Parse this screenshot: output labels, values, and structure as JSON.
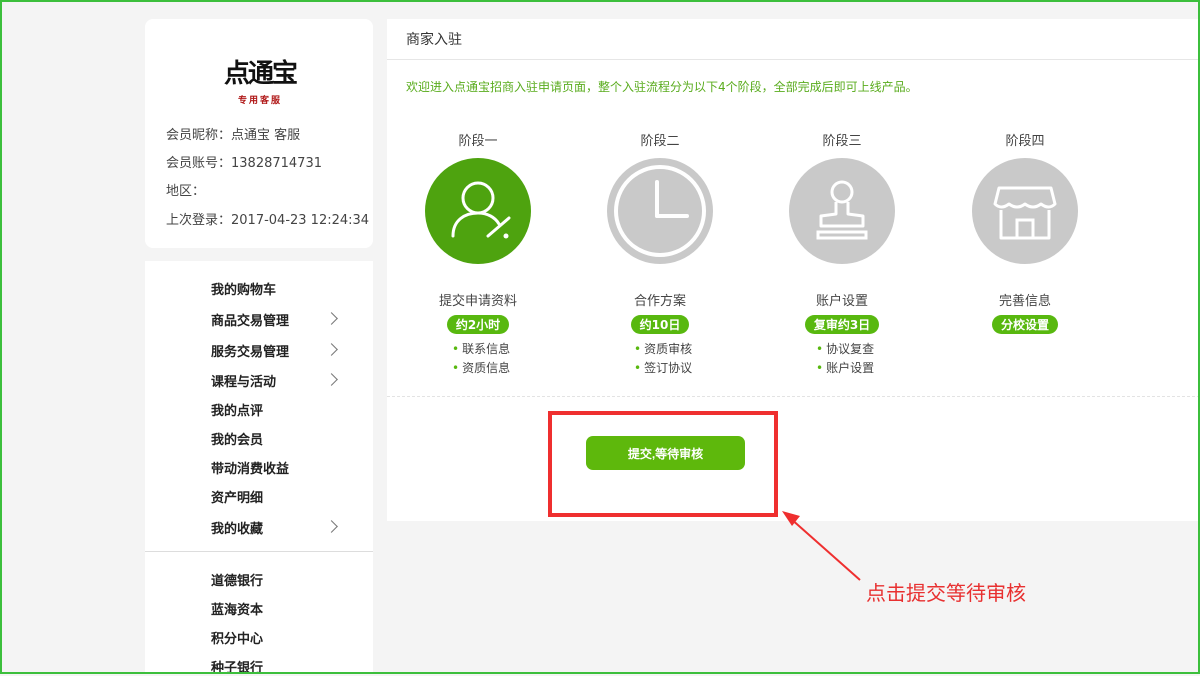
{
  "profile": {
    "logo_text": "点通宝",
    "logo_subtext": "专用客服",
    "nickname": "会员昵称：点通宝 客服",
    "account": "会员账号：13828714731",
    "region": "地区：",
    "last_login": "上次登录：2017-04-23 12:24:34"
  },
  "menu": {
    "items": [
      {
        "label": "我的购物车"
      },
      {
        "label": "商品交易管理"
      },
      {
        "label": "服务交易管理"
      },
      {
        "label": "课程与活动"
      },
      {
        "label": "我的点评"
      },
      {
        "label": "我的会员"
      },
      {
        "label": "带动消费收益"
      },
      {
        "label": "资产明细"
      },
      {
        "label": "我的收藏"
      },
      {
        "label": "道德银行"
      },
      {
        "label": "蓝海资本"
      },
      {
        "label": "积分中心"
      },
      {
        "label": "种子银行"
      }
    ]
  },
  "panel": {
    "title": "商家入驻",
    "welcome": "欢迎进入点通宝招商入驻申请页面，整个入驻流程分为以下4个阶段，全部完成后即可上线产品。",
    "stages": [
      {
        "label": "阶段一",
        "icon": "user-edit-icon",
        "name": "提交申请资料",
        "badge": "约2小时",
        "bullets": [
          "联系信息",
          "资质信息"
        ]
      },
      {
        "label": "阶段二",
        "icon": "clock-icon",
        "name": "合作方案",
        "badge": "约10日",
        "bullets": [
          "资质审核",
          "签订协议"
        ]
      },
      {
        "label": "阶段三",
        "icon": "stamp-icon",
        "name": "账户设置",
        "badge": "复审约3日",
        "bullets": [
          "协议复查",
          "账户设置"
        ]
      },
      {
        "label": "阶段四",
        "icon": "shop-icon",
        "name": "完善信息",
        "badge": "分校设置",
        "bullets": []
      }
    ],
    "submit_label": "提交,等待审核"
  },
  "annotation": {
    "hint": "点击提交等待审核"
  },
  "colors": {
    "accent_green": "#5eb80c",
    "active_stage": "#4ea30f",
    "inactive_stage": "#c9c9c9",
    "annotation_red": "#ef2f2f",
    "frame_green": "#3cbf3c"
  }
}
